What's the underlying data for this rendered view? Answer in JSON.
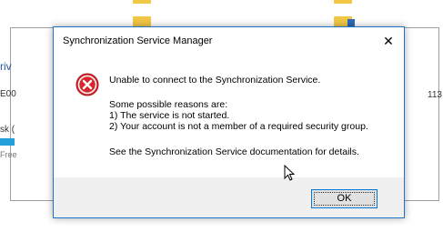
{
  "background": {
    "drive_label": "riv",
    "code_text": "E00",
    "disk_text": "sk (",
    "free_text": "Free",
    "number_text": "113"
  },
  "dialog": {
    "title": "Synchronization Service Manager",
    "close_glyph": "✕",
    "icon": "error-icon",
    "message_lines": [
      "Unable to connect to the Synchronization Service.",
      "Some possible reasons are:",
      "1) The service is not started.",
      "2) Your account is not a member of a required security group.",
      "See the Synchronization Service documentation for details."
    ],
    "ok_label": "OK"
  },
  "colors": {
    "dialog_border": "#1f74c9",
    "error_red": "#d9262c",
    "footer_bg": "#f0f0f0",
    "folder_yellow": "#f3c746"
  }
}
